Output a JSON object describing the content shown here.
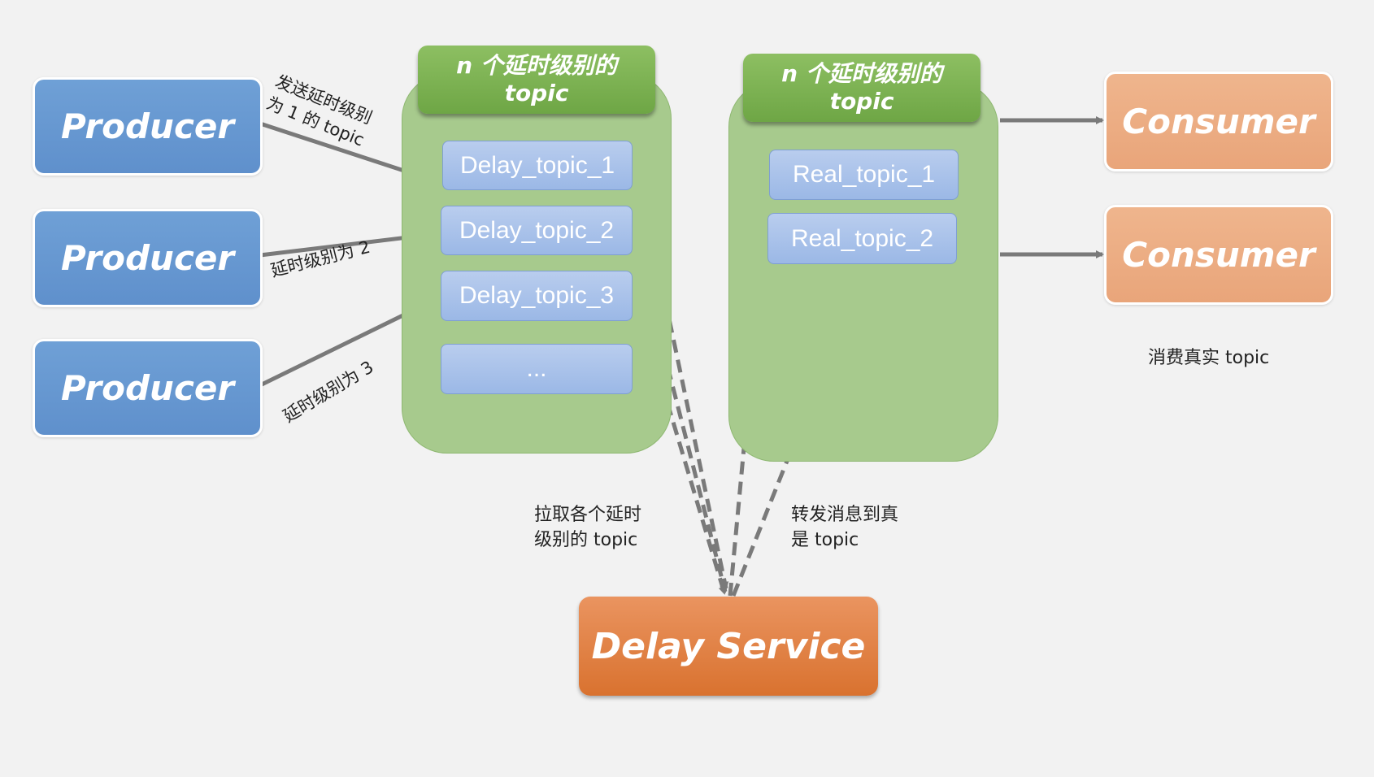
{
  "producers": [
    "Producer",
    "Producer",
    "Producer"
  ],
  "consumers": [
    "Consumer",
    "Consumer"
  ],
  "delay_group": {
    "header": "n 个延时级别的\ntopic",
    "topics": [
      "Delay_topic_1",
      "Delay_topic_2",
      "Delay_topic_3",
      "..."
    ]
  },
  "real_group": {
    "header": "n 个延时级别的\ntopic",
    "topics": [
      "Real_topic_1",
      "Real_topic_2"
    ]
  },
  "service": "Delay Service",
  "labels": {
    "send_level_1": "发送延时级别\n为 1 的 topic",
    "level_2": "延时级别为 2",
    "level_3": "延时级别为 3",
    "pull": "拉取各个延时\n级别的 topic",
    "forward": "转发消息到真\n是 topic",
    "consume": "消费真实 topic"
  },
  "colors": {
    "producer": "#6598d1",
    "consumer": "#eeaf86",
    "container": "#a7ca8d",
    "header": "#7db152",
    "topic_box": "#a9c3ea",
    "service": "#e3813f",
    "arrow": "#7a7a7a"
  }
}
